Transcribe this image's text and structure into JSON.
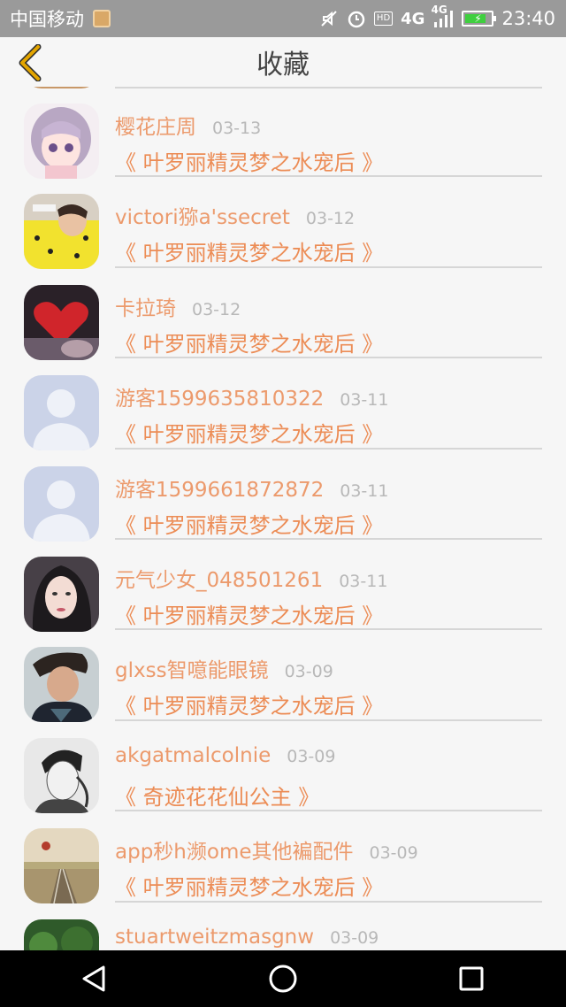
{
  "status_bar": {
    "carrier": "中国移动",
    "app_icon": "gallery-icon",
    "icons": [
      "mute-icon",
      "alarm-icon",
      "hd-icon",
      "4g-signal-icon",
      "4g-signal-icon",
      "battery-charging-icon"
    ],
    "hd": "HD",
    "net1": "4G",
    "net2": "4G",
    "time": "23:40"
  },
  "header": {
    "title": "收藏",
    "back_icon": "back-chevron-icon",
    "back_color": "#e3a500"
  },
  "items": [
    {
      "user": "樱花庄周",
      "date": "03-13",
      "book": "《 叶罗丽精灵梦之水宠后 》",
      "avatar": "anime-girl-avatar"
    },
    {
      "user": "victori猕a'ssecret",
      "date": "03-12",
      "book": "《 叶罗丽精灵梦之水宠后 》",
      "avatar": "yellow-jacket-avatar"
    },
    {
      "user": "卡拉琦",
      "date": "03-12",
      "book": "《 叶罗丽精灵梦之水宠后 》",
      "avatar": "red-heart-avatar"
    },
    {
      "user": "游客1599635810322",
      "date": "03-11",
      "book": "《 叶罗丽精灵梦之水宠后 》",
      "avatar": "default-user-avatar"
    },
    {
      "user": "游客1599661872872",
      "date": "03-11",
      "book": "《 叶罗丽精灵梦之水宠后 》",
      "avatar": "default-user-avatar"
    },
    {
      "user": "元气少女_048501261",
      "date": "03-11",
      "book": "《 叶罗丽精灵梦之水宠后 》",
      "avatar": "girl-portrait-avatar"
    },
    {
      "user": "glxss智噫能眼镜",
      "date": "03-09",
      "book": "《 叶罗丽精灵梦之水宠后 》",
      "avatar": "man-portrait-avatar"
    },
    {
      "user": "akgatmalcolnie",
      "date": "03-09",
      "book": "《 奇迹花花仙公主 》",
      "avatar": "sketch-portrait-avatar"
    },
    {
      "user": "app秒h濒ome其他褊配件",
      "date": "03-09",
      "book": "《 叶罗丽精灵梦之水宠后 》",
      "avatar": "railway-avatar"
    },
    {
      "user": "stuartweitzmasgnw",
      "date": "03-09",
      "book": "",
      "avatar": "green-nature-avatar"
    }
  ],
  "colors": {
    "username": "#ec9a6c",
    "book": "#ec8c55",
    "date": "#b8b8b8",
    "status_bar": "#9a9a9a",
    "background": "#f6f6f6"
  },
  "nav_bar": {
    "buttons": [
      "back-triangle-icon",
      "home-circle-icon",
      "recents-square-icon"
    ]
  }
}
